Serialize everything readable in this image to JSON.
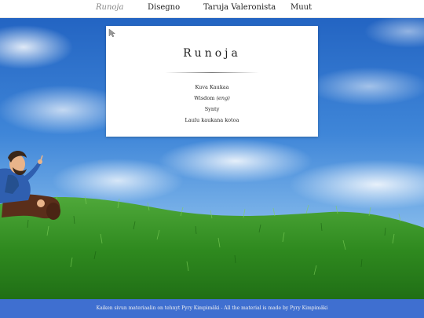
{
  "nav": {
    "items": [
      {
        "label": "Runoja",
        "active": true
      },
      {
        "label": "Disegno",
        "active": false
      },
      {
        "label": "Taruja Valeronista",
        "active": false
      },
      {
        "label": "Muut",
        "active": false
      }
    ]
  },
  "panel": {
    "title": "Runoja",
    "links": [
      {
        "label": "Kuva Kaukaa"
      },
      {
        "label": "Wisdom",
        "note": "(eng)"
      },
      {
        "label": "Synty"
      },
      {
        "label": "Laulu kaukana kotoa"
      }
    ]
  },
  "footer": {
    "text": "Kaiken sivun materiaalin on tehnyt Pyry Kimpimäki - All the material is made by Pyry Kimpimäki"
  },
  "colors": {
    "footer_bg": "#3f6fd0",
    "grass": "#2f8a1f",
    "sky": "#3a7fd0"
  }
}
